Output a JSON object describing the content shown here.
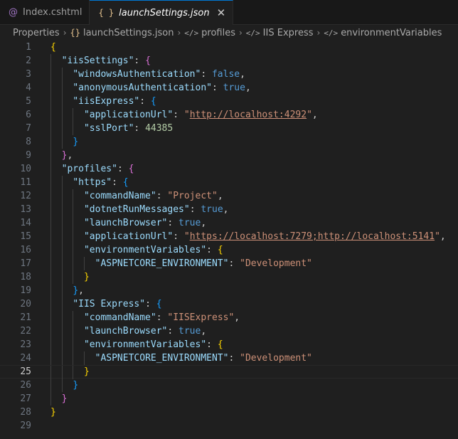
{
  "tabs": [
    {
      "label": "Index.cshtml",
      "icon": "razor-file-icon"
    },
    {
      "label": "launchSettings.json",
      "icon": "json-file-icon",
      "active": true
    }
  ],
  "breadcrumb": [
    "Properties",
    "launchSettings.json",
    "profiles",
    "IIS Express",
    "environmentVariables"
  ],
  "editor": {
    "current_line": 25,
    "lines": [
      {
        "n": "1",
        "t": [
          [
            "{",
            "br1"
          ]
        ]
      },
      {
        "n": "2",
        "t": [
          [
            "  ",
            ""
          ],
          [
            "\"iisSettings\"",
            "k"
          ],
          [
            ": ",
            "p"
          ],
          [
            "{",
            "br2"
          ]
        ]
      },
      {
        "n": "3",
        "t": [
          [
            "    ",
            ""
          ],
          [
            "\"windowsAuthentication\"",
            "k"
          ],
          [
            ": ",
            "p"
          ],
          [
            "false",
            "b"
          ],
          [
            ",",
            "p"
          ]
        ]
      },
      {
        "n": "4",
        "t": [
          [
            "    ",
            ""
          ],
          [
            "\"anonymousAuthentication\"",
            "k"
          ],
          [
            ": ",
            "p"
          ],
          [
            "true",
            "b"
          ],
          [
            ",",
            "p"
          ]
        ]
      },
      {
        "n": "5",
        "t": [
          [
            "    ",
            ""
          ],
          [
            "\"iisExpress\"",
            "k"
          ],
          [
            ": ",
            "p"
          ],
          [
            "{",
            "br3"
          ]
        ]
      },
      {
        "n": "6",
        "t": [
          [
            "      ",
            ""
          ],
          [
            "\"applicationUrl\"",
            "k"
          ],
          [
            ": ",
            "p"
          ],
          [
            "\"",
            "s"
          ],
          [
            "http://localhost:4292",
            "s url"
          ],
          [
            "\"",
            "s"
          ],
          [
            ",",
            "p"
          ]
        ]
      },
      {
        "n": "7",
        "t": [
          [
            "      ",
            ""
          ],
          [
            "\"sslPort\"",
            "k"
          ],
          [
            ": ",
            "p"
          ],
          [
            "44385",
            "n"
          ]
        ]
      },
      {
        "n": "8",
        "t": [
          [
            "    ",
            ""
          ],
          [
            "}",
            "br3"
          ]
        ]
      },
      {
        "n": "9",
        "t": [
          [
            "  ",
            ""
          ],
          [
            "}",
            "br2"
          ],
          [
            ",",
            "p"
          ]
        ]
      },
      {
        "n": "10",
        "t": [
          [
            "  ",
            ""
          ],
          [
            "\"profiles\"",
            "k"
          ],
          [
            ": ",
            "p"
          ],
          [
            "{",
            "br2"
          ]
        ]
      },
      {
        "n": "11",
        "t": [
          [
            "    ",
            ""
          ],
          [
            "\"https\"",
            "k"
          ],
          [
            ": ",
            "p"
          ],
          [
            "{",
            "br3"
          ]
        ]
      },
      {
        "n": "12",
        "t": [
          [
            "      ",
            ""
          ],
          [
            "\"commandName\"",
            "k"
          ],
          [
            ": ",
            "p"
          ],
          [
            "\"Project\"",
            "s"
          ],
          [
            ",",
            "p"
          ]
        ]
      },
      {
        "n": "13",
        "t": [
          [
            "      ",
            ""
          ],
          [
            "\"dotnetRunMessages\"",
            "k"
          ],
          [
            ": ",
            "p"
          ],
          [
            "true",
            "b"
          ],
          [
            ",",
            "p"
          ]
        ]
      },
      {
        "n": "14",
        "t": [
          [
            "      ",
            ""
          ],
          [
            "\"launchBrowser\"",
            "k"
          ],
          [
            ": ",
            "p"
          ],
          [
            "true",
            "b"
          ],
          [
            ",",
            "p"
          ]
        ]
      },
      {
        "n": "15",
        "t": [
          [
            "      ",
            ""
          ],
          [
            "\"applicationUrl\"",
            "k"
          ],
          [
            ": ",
            "p"
          ],
          [
            "\"",
            "s"
          ],
          [
            "https://localhost:7279;http://localhost:5141",
            "s url"
          ],
          [
            "\"",
            "s"
          ],
          [
            ",",
            "p"
          ]
        ]
      },
      {
        "n": "16",
        "t": [
          [
            "      ",
            ""
          ],
          [
            "\"environmentVariables\"",
            "k"
          ],
          [
            ": ",
            "p"
          ],
          [
            "{",
            "br1"
          ]
        ]
      },
      {
        "n": "17",
        "t": [
          [
            "        ",
            ""
          ],
          [
            "\"ASPNETCORE_ENVIRONMENT\"",
            "k"
          ],
          [
            ": ",
            "p"
          ],
          [
            "\"Development\"",
            "s"
          ]
        ]
      },
      {
        "n": "18",
        "t": [
          [
            "      ",
            ""
          ],
          [
            "}",
            "br1"
          ]
        ]
      },
      {
        "n": "19",
        "t": [
          [
            "    ",
            ""
          ],
          [
            "}",
            "br3"
          ],
          [
            ",",
            "p"
          ]
        ]
      },
      {
        "n": "20",
        "t": [
          [
            "    ",
            ""
          ],
          [
            "\"IIS Express\"",
            "k"
          ],
          [
            ": ",
            "p"
          ],
          [
            "{",
            "br3"
          ]
        ]
      },
      {
        "n": "21",
        "t": [
          [
            "      ",
            ""
          ],
          [
            "\"commandName\"",
            "k"
          ],
          [
            ": ",
            "p"
          ],
          [
            "\"IISExpress\"",
            "s"
          ],
          [
            ",",
            "p"
          ]
        ]
      },
      {
        "n": "22",
        "t": [
          [
            "      ",
            ""
          ],
          [
            "\"launchBrowser\"",
            "k"
          ],
          [
            ": ",
            "p"
          ],
          [
            "true",
            "b"
          ],
          [
            ",",
            "p"
          ]
        ]
      },
      {
        "n": "23",
        "t": [
          [
            "      ",
            ""
          ],
          [
            "\"environmentVariables\"",
            "k"
          ],
          [
            ": ",
            "p"
          ],
          [
            "{",
            "br1"
          ]
        ]
      },
      {
        "n": "24",
        "t": [
          [
            "        ",
            ""
          ],
          [
            "\"ASPNETCORE_ENVIRONMENT\"",
            "k"
          ],
          [
            ": ",
            "p"
          ],
          [
            "\"Development\"",
            "s"
          ]
        ]
      },
      {
        "n": "25",
        "t": [
          [
            "      ",
            ""
          ],
          [
            "}",
            "br1"
          ]
        ]
      },
      {
        "n": "26",
        "t": [
          [
            "    ",
            ""
          ],
          [
            "}",
            "br3"
          ]
        ]
      },
      {
        "n": "27",
        "t": [
          [
            "  ",
            ""
          ],
          [
            "}",
            "br2"
          ]
        ]
      },
      {
        "n": "28",
        "t": [
          [
            "}",
            "br1"
          ]
        ]
      },
      {
        "n": "29",
        "t": []
      }
    ]
  }
}
